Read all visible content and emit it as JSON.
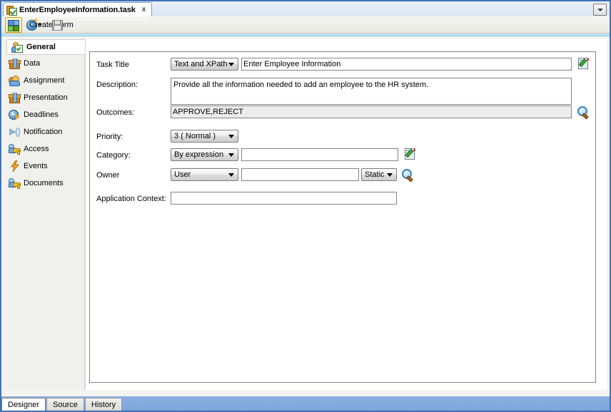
{
  "window": {
    "tab_title": "EnterEmployeeInformation.task",
    "tab_close": "x",
    "tab_icon": "task-file-icon",
    "tab_menu_icon": "chevron-down-icon"
  },
  "toolbar": {
    "flow_icon": "flow-diagram-icon",
    "create_form_label": "Create Form",
    "create_form_icon": "new-form-icon",
    "create_form_caret": "caret-down-icon",
    "save_icon": "save-disk-icon"
  },
  "sidebar": {
    "items": [
      {
        "label": "General",
        "icon": "user-check-icon",
        "active": true
      },
      {
        "label": "Data",
        "icon": "data-box-icon",
        "active": false
      },
      {
        "label": "Assignment",
        "icon": "people-icon",
        "active": false
      },
      {
        "label": "Presentation",
        "icon": "presentation-box-icon",
        "active": false
      },
      {
        "label": "Deadlines",
        "icon": "clock-icon",
        "active": false
      },
      {
        "label": "Notification",
        "icon": "megaphone-icon",
        "active": false
      },
      {
        "label": "Access",
        "icon": "user-key-icon",
        "active": false
      },
      {
        "label": "Events",
        "icon": "lightning-bolt-icon",
        "active": false
      },
      {
        "label": "Documents",
        "icon": "user-key-icon",
        "active": false
      }
    ]
  },
  "form": {
    "task_title": {
      "label": "Task Title",
      "mode_value": "Text and XPath",
      "value": "Enter Employee Information",
      "edit_icon": "edit-expression-icon"
    },
    "description": {
      "label": "Description:",
      "value": "Provide all the information needed to add an employee to the HR system."
    },
    "outcomes": {
      "label": "Outcomes:",
      "value": "APPROVE,REJECT",
      "search_icon": "search-icon"
    },
    "priority": {
      "label": "Priority:",
      "value": "3  ( Normal )"
    },
    "category": {
      "label": "Category:",
      "mode_value": "By expression",
      "value": "",
      "edit_icon": "edit-expression-icon"
    },
    "owner": {
      "label": "Owner",
      "type_value": "User",
      "value": "",
      "static_value": "Static",
      "search_icon": "search-icon"
    },
    "application_context": {
      "label": "Application Context:",
      "value": ""
    }
  },
  "bottom_tabs": [
    {
      "label": "Designer",
      "selected": true
    },
    {
      "label": "Source",
      "selected": false
    },
    {
      "label": "History",
      "selected": false
    }
  ]
}
